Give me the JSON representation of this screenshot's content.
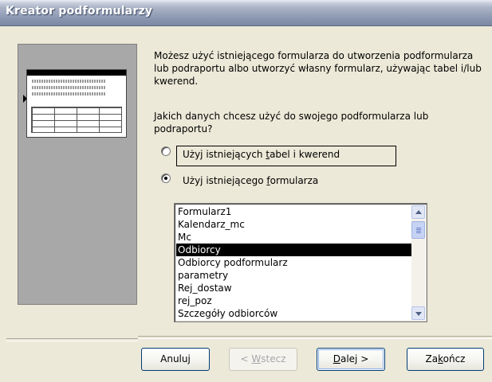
{
  "window": {
    "title": "Kreator podformularzy"
  },
  "description": {
    "line1": "Możesz użyć istniejącego formularza do utworzenia podformularza",
    "line2": "lub podraportu albo utworzyć własny formularz, używając tabel i/lub",
    "line3": "kwerend."
  },
  "question": {
    "line1": "Jakich danych chcesz użyć do swojego podformularza lub",
    "line2": "podraportu?"
  },
  "options": {
    "tables": {
      "before": "Użyj istniejących ",
      "key": "t",
      "after": "abel i kwerend",
      "selected": false
    },
    "form": {
      "before": "Użyj istniejącego ",
      "key": "f",
      "after": "ormularza",
      "selected": true
    }
  },
  "forms_list": {
    "items": [
      "Formularz1",
      "Kalendarz_mc",
      "Mc",
      "Odbiorcy",
      "Odbiorcy podformularz",
      "parametry",
      "Rej_dostaw",
      "rej_poz",
      "Szczegóły odbiorców"
    ],
    "selected": "Odbiorcy"
  },
  "buttons": {
    "cancel": {
      "label": "Anuluj",
      "enabled": true
    },
    "back": {
      "before": "< ",
      "key": "W",
      "after": "stecz",
      "enabled": false
    },
    "next": {
      "key": "D",
      "after": "alej >",
      "enabled": true
    },
    "finish": {
      "before": "Za",
      "key": "k",
      "after": "ończ",
      "enabled": true
    }
  },
  "colors": {
    "selection": "#000000",
    "window_bg": "#ece9d8",
    "preview_bg": "#a8a8a8"
  }
}
